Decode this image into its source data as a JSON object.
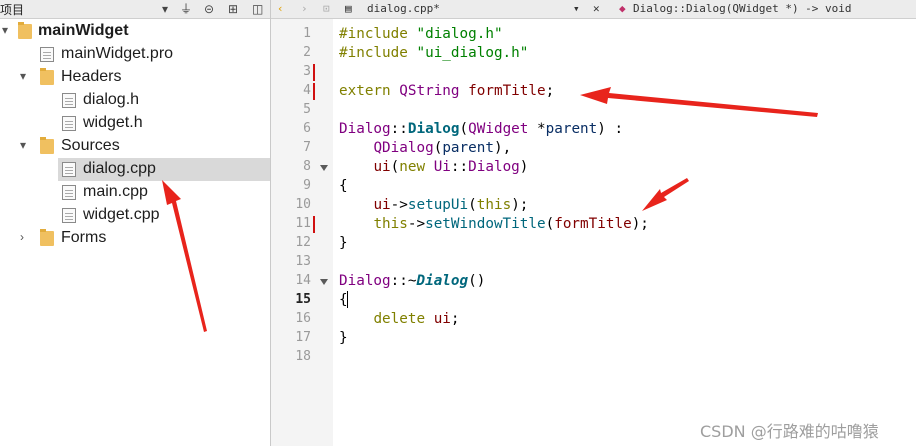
{
  "project_panel": {
    "title": "项目",
    "tree": [
      {
        "label": "mainWidget",
        "kind": "project",
        "expanded": true
      },
      {
        "label": "mainWidget.pro",
        "kind": "pro-file"
      },
      {
        "label": "Headers",
        "kind": "folder",
        "expanded": true
      },
      {
        "label": "dialog.h",
        "kind": "file"
      },
      {
        "label": "widget.h",
        "kind": "file"
      },
      {
        "label": "Sources",
        "kind": "folder",
        "expanded": true
      },
      {
        "label": "dialog.cpp",
        "kind": "file",
        "selected": true
      },
      {
        "label": "main.cpp",
        "kind": "file"
      },
      {
        "label": "widget.cpp",
        "kind": "file"
      },
      {
        "label": "Forms",
        "kind": "folder",
        "expanded": false
      }
    ]
  },
  "editor": {
    "tab_file": "dialog.cpp*",
    "symbol": "Dialog::Dialog(QWidget *) -> void",
    "current_line": "15",
    "line_numbers": [
      "1",
      "2",
      "3",
      "4",
      "5",
      "6",
      "7",
      "8",
      "9",
      "10",
      "11",
      "12",
      "13",
      "14",
      "15",
      "16",
      "17",
      "18"
    ],
    "lines": [
      "#include \"dialog.h\"",
      "#include \"ui_dialog.h\"",
      "",
      "extern QString formTitle;",
      "",
      "Dialog::Dialog(QWidget *parent) :",
      "    QDialog(parent),",
      "    ui(new Ui::Dialog)",
      "{",
      "    ui->setupUi(this);",
      "    this->setWindowTitle(formTitle);",
      "}",
      "",
      "Dialog::~Dialog()",
      "{",
      "    delete ui;",
      "}",
      ""
    ],
    "modified_lines": [
      "3",
      "4",
      "11"
    ],
    "fold_lines": [
      "8",
      "14"
    ]
  },
  "watermark": "CSDN @行路难的咕噜猿",
  "colors": {
    "keyword": "#808000",
    "string": "#008000",
    "type": "#800080",
    "function": "#00677c",
    "change_marker": "#d01010",
    "annotation_arrow": "#e8241c",
    "selected_row": "#d9d9d9"
  }
}
